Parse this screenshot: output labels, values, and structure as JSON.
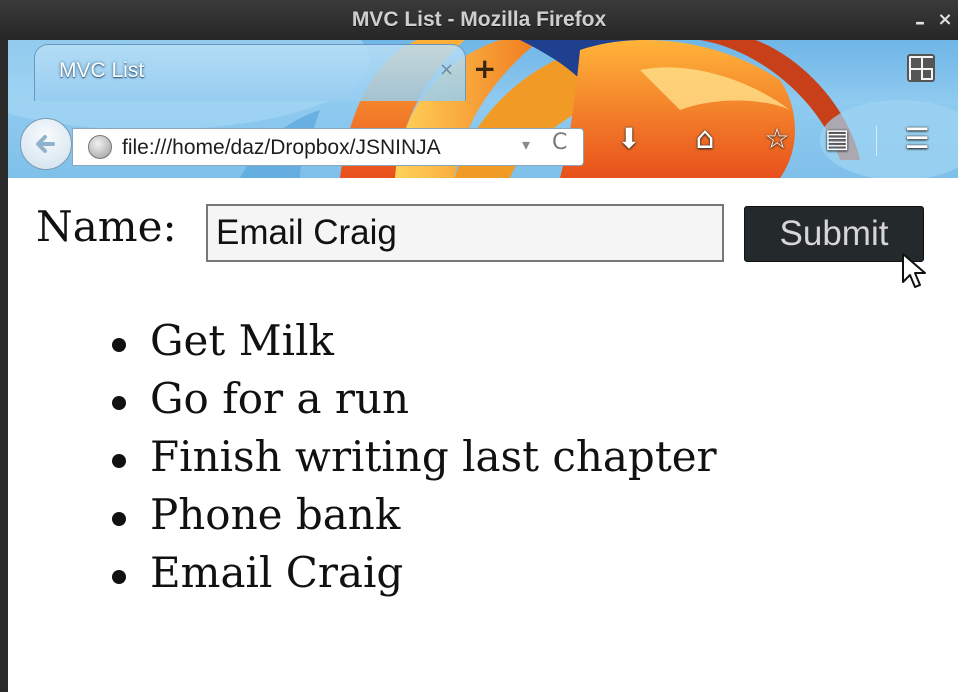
{
  "window": {
    "title": "MVC List - Mozilla Firefox",
    "minimize_label": "–",
    "close_label": "×"
  },
  "browser": {
    "tab": {
      "label": "MVC List",
      "close_label": "×"
    },
    "new_tab_label": "+",
    "url": "file:///home/daz/Dropbox/JSNINJA",
    "dropdown_glyph": "▾",
    "reload_glyph": "C",
    "toolbar_icons": [
      "download-icon",
      "home-icon",
      "bookmark-star-icon",
      "reader-list-icon",
      "menu-icon"
    ],
    "toolbar_glyphs": {
      "download": "⬇",
      "home": "⌂",
      "bookmark": "☆",
      "reader": "▤",
      "menu": "☰"
    }
  },
  "form": {
    "label": "Name:",
    "input_value": "Email Craig",
    "submit_label": "Submit"
  },
  "items": [
    "Get Milk",
    "Go for a run",
    "Finish writing last chapter",
    "Phone bank",
    "Email Craig"
  ]
}
